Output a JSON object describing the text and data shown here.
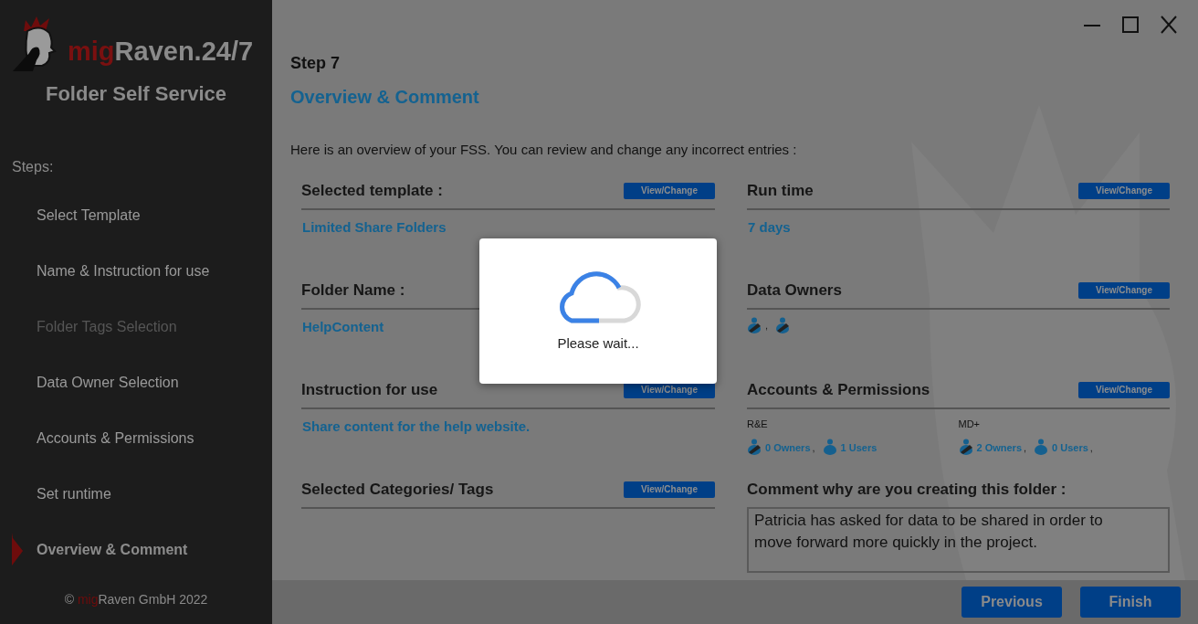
{
  "sidebar": {
    "logo": {
      "prefix": "mig",
      "rest": "Raven.24/7"
    },
    "app_title": "Folder Self Service",
    "steps_label": "Steps:",
    "steps": [
      {
        "label": "Select Template",
        "selected": false,
        "disabled": false
      },
      {
        "label": "Name & Instruction for use",
        "selected": false,
        "disabled": false
      },
      {
        "label": "Folder Tags Selection",
        "selected": false,
        "disabled": true
      },
      {
        "label": "Data Owner Selection",
        "selected": false,
        "disabled": false
      },
      {
        "label": "Accounts & Permissions",
        "selected": false,
        "disabled": false
      },
      {
        "label": "Set runtime",
        "selected": false,
        "disabled": false
      },
      {
        "label": "Overview & Comment",
        "selected": true,
        "disabled": false
      }
    ],
    "footer": {
      "symbol": "©",
      "prefix": "mig",
      "rest": "Raven GmbH 2022"
    }
  },
  "main": {
    "step": "Step 7",
    "title": "Overview & Comment",
    "intro": "Here is an overview of your FSS. You can review and change any incorrect entries :",
    "left": [
      {
        "title": "Selected template :",
        "button": "View/Change",
        "kind": "text",
        "value": "Limited Share Folders"
      },
      {
        "title": "Folder Name :",
        "kind": "text",
        "value": "HelpContent"
      },
      {
        "title": "Instruction for use",
        "button": "View/Change",
        "kind": "text",
        "value": "Share content for the help website."
      },
      {
        "title": "Selected Categories/ Tags",
        "button": "View/Change",
        "kind": "empty"
      }
    ],
    "right": [
      {
        "title": "Run time",
        "button": "View/Change",
        "kind": "text",
        "value": "7 days"
      },
      {
        "title": "Data Owners",
        "button": "View/Change",
        "kind": "people",
        "people": [
          {
            "kind": "owner",
            "separator": ","
          },
          {
            "kind": "owner"
          }
        ]
      },
      {
        "title": "Accounts & Permissions",
        "button": "View/Change",
        "kind": "permissions",
        "groups": [
          {
            "name": "R&E",
            "entries": [
              {
                "kind": "owner",
                "label": "0 Owners",
                "separator": ","
              },
              {
                "kind": "user",
                "label": "1 Users"
              }
            ]
          },
          {
            "name": "MD+",
            "entries": [
              {
                "kind": "owner",
                "label": "2 Owners",
                "separator": ","
              },
              {
                "kind": "user",
                "label": "0 Users",
                "separator": ","
              }
            ]
          }
        ]
      },
      {
        "title": "Comment why are you creating this folder :",
        "kind": "comment",
        "value": "Patricia has asked for data to be shared in order to move forward more quickly in the project."
      }
    ]
  },
  "modal": {
    "message": "Please wait..."
  },
  "footer_buttons": [
    "Previous",
    "Finish"
  ]
}
